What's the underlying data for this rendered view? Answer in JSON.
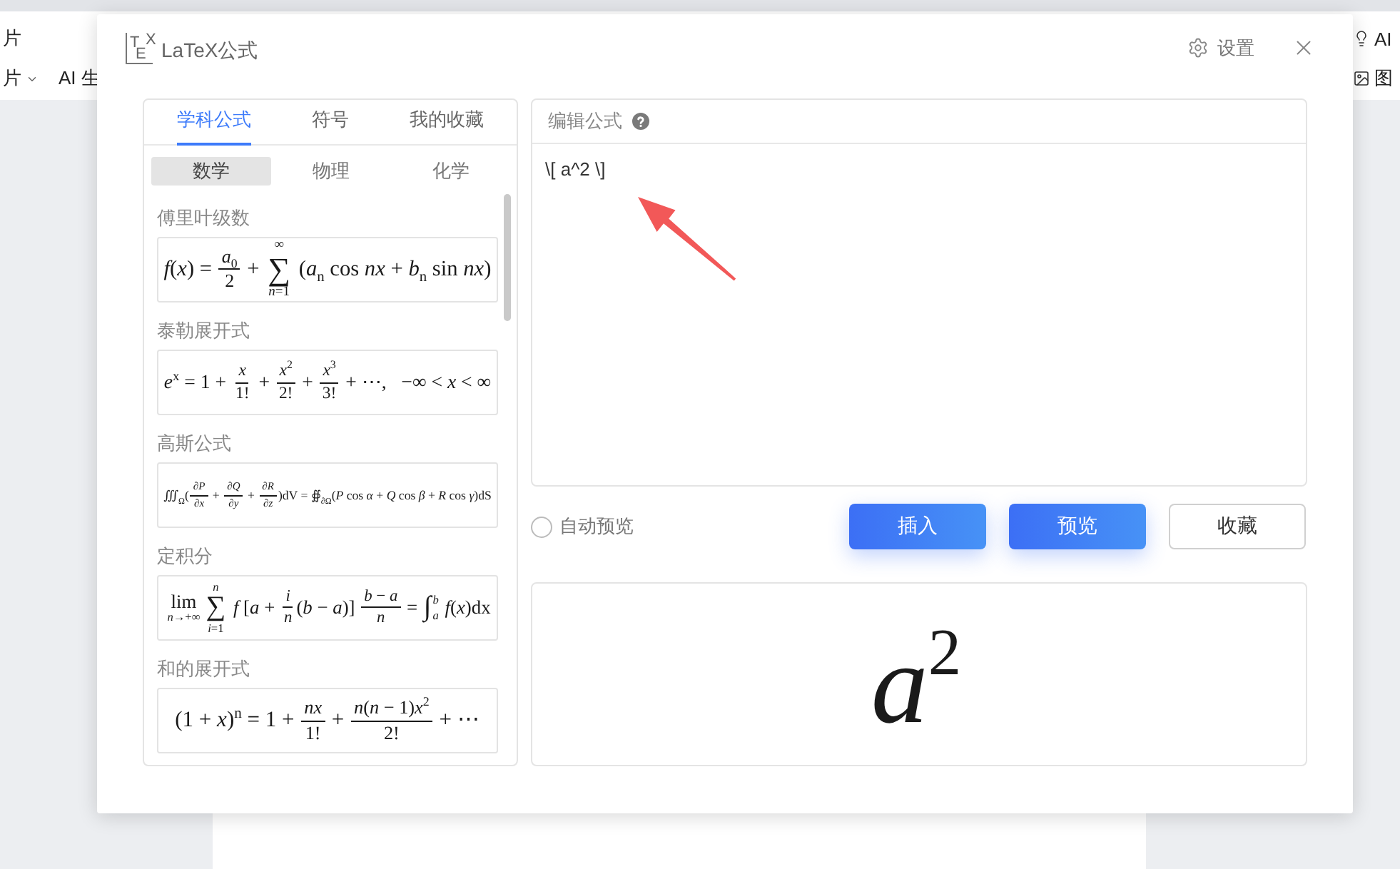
{
  "app_toolbar": {
    "left": [
      {
        "label": "片",
        "has_menu": false
      },
      {
        "label": "片",
        "has_menu": true
      }
    ],
    "ai_generate": {
      "label": "AI 生"
    },
    "right": [
      {
        "label": "AI",
        "kind": "ai-tool"
      },
      {
        "label": "图",
        "kind": "image"
      }
    ]
  },
  "dialog": {
    "logo": "TEX",
    "title": "LaTeX公式",
    "settings": "设置"
  },
  "library": {
    "tabs": [
      {
        "label": "学科公式",
        "selected": true
      },
      {
        "label": "符号",
        "selected": false
      },
      {
        "label": "我的收藏",
        "selected": false
      }
    ],
    "subjects": [
      {
        "label": "数学",
        "selected": true
      },
      {
        "label": "物理",
        "selected": false
      },
      {
        "label": "化学",
        "selected": false
      }
    ],
    "formulas": [
      {
        "name": "傅里叶级数",
        "pieces": [
          {
            "kind": "text",
            "text": "*f*(*x*) = "
          },
          {
            "kind": "frac",
            "num": "*a*$_{0}$",
            "den": "2"
          },
          {
            "kind": "text",
            "text": " + "
          },
          {
            "kind": "bigop",
            "symbol": "∑",
            "over": "∞",
            "under": "*n*=1"
          },
          {
            "kind": "text",
            "text": " (*a*$_{n}$ cos *nx* + *b*$_{n}$ sin *nx*)"
          }
        ]
      },
      {
        "name": "泰勒展开式",
        "pieces": [
          {
            "kind": "text",
            "text": "*e*$^{x}$ = 1 + "
          },
          {
            "kind": "frac",
            "num": "*x*",
            "den": "1!"
          },
          {
            "kind": "text",
            "text": " + "
          },
          {
            "kind": "frac",
            "num": "*x*$^{2}$",
            "den": "2!"
          },
          {
            "kind": "text",
            "text": " + "
          },
          {
            "kind": "frac",
            "num": "*x*$^{3}$",
            "den": "3!"
          },
          {
            "kind": "text",
            "text": " + ⋯,   −∞ < *x* < ∞"
          }
        ]
      },
      {
        "name": "高斯公式",
        "pieces": [
          {
            "kind": "text",
            "text": "∭$_{Ω}$("
          },
          {
            "kind": "frac",
            "num": "∂*P*",
            "den": "∂*x*"
          },
          {
            "kind": "text",
            "text": " + "
          },
          {
            "kind": "frac",
            "num": "∂*Q*",
            "den": "∂*y*"
          },
          {
            "kind": "text",
            "text": " + "
          },
          {
            "kind": "frac",
            "num": "∂*R*",
            "den": "∂*z*"
          },
          {
            "kind": "text",
            "text": ")dV = ∯$_{∂Ω}$(*P* cos *α* + *Q* cos *β* + *R* cos *γ*)dS"
          }
        ]
      },
      {
        "name": "定积分",
        "pieces": [
          {
            "kind": "lim",
            "symbol": "lim",
            "under": "*n*→+∞"
          },
          {
            "kind": "bigop",
            "symbol": "∑",
            "over": "*n*",
            "under": "*i*=1"
          },
          {
            "kind": "text",
            "text": " *f* [*a* + "
          },
          {
            "kind": "frac",
            "num": "*i*",
            "den": "*n*"
          },
          {
            "kind": "text",
            "text": "(*b* − *a*)] "
          },
          {
            "kind": "frac",
            "num": "*b* − *a*",
            "den": "*n*"
          },
          {
            "kind": "text",
            "text": " = "
          },
          {
            "kind": "script",
            "symbol": "∫",
            "over": "*b*",
            "under": "*a*"
          },
          {
            "kind": "text",
            "text": " *f*(*x*)dx"
          }
        ]
      },
      {
        "name": "和的展开式",
        "pieces": [
          {
            "kind": "text",
            "text": "(1 + *x*)$^{n}$ = 1 + "
          },
          {
            "kind": "frac",
            "num": "*nx*",
            "den": "1!"
          },
          {
            "kind": "text",
            "text": " + "
          },
          {
            "kind": "frac",
            "num": "*n*(*n* − 1)*x*$^{2}$",
            "den": "2!"
          },
          {
            "kind": "text",
            "text": " + ⋯"
          }
        ]
      }
    ]
  },
  "editor": {
    "header": "编辑公式",
    "value": "\\[ a^2 \\]",
    "auto_preview": {
      "label": "自动预览",
      "checked": false
    },
    "buttons": [
      {
        "label": "插入",
        "kind": "primary"
      },
      {
        "label": "预览",
        "kind": "primary"
      },
      {
        "label": "收藏",
        "kind": "secondary"
      }
    ],
    "preview": {
      "formula": "*a*$^{2}$"
    }
  }
}
